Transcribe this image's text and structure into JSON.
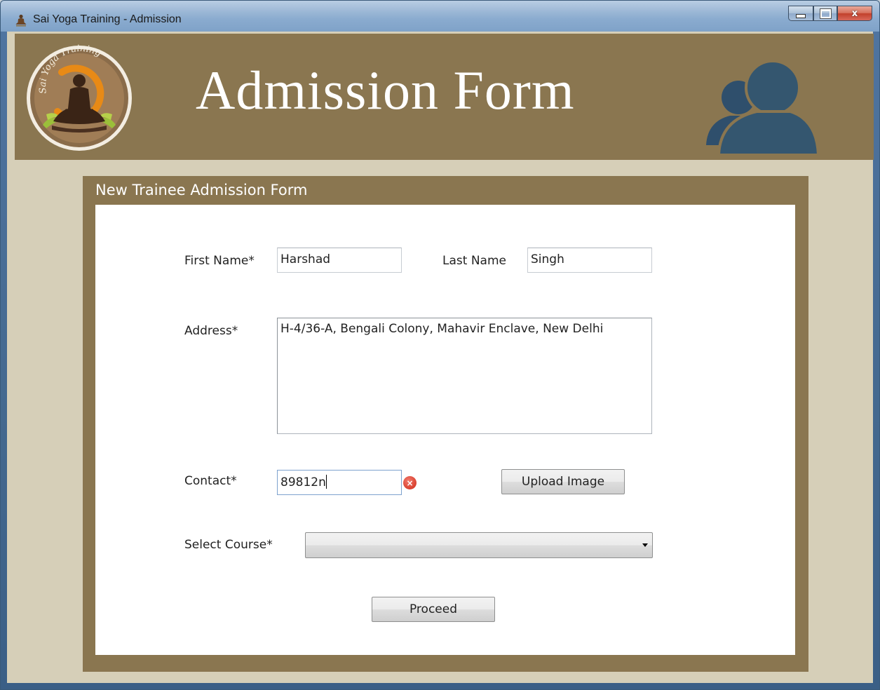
{
  "window": {
    "title": "Sai Yoga Training - Admission",
    "min_glyph": "",
    "max_glyph": "",
    "close_glyph": "x"
  },
  "header": {
    "title": "Admission Form",
    "logo_text": "Sai Yoga Training",
    "logo_icon": "meditating-yogi-logo",
    "right_icon": "users-icon",
    "bg_color": "#8a7650"
  },
  "form": {
    "panel_title": "New Trainee Admission Form",
    "first_name_label": "First Name*",
    "first_name_value": "Harshad",
    "last_name_label": "Last Name",
    "last_name_value": "Singh",
    "address_label": "Address*",
    "address_value": "H-4/36-A, Bengali Colony, Mahavir Enclave, New Delhi",
    "contact_label": "Contact*",
    "contact_value": "89812n",
    "contact_error_icon": "error-icon",
    "upload_button": "Upload Image",
    "course_label": "Select Course*",
    "course_value": "",
    "proceed_button": "Proceed"
  },
  "colors": {
    "panel": "#8a7650",
    "background": "#d6cfb8",
    "error": "#d9402f"
  }
}
